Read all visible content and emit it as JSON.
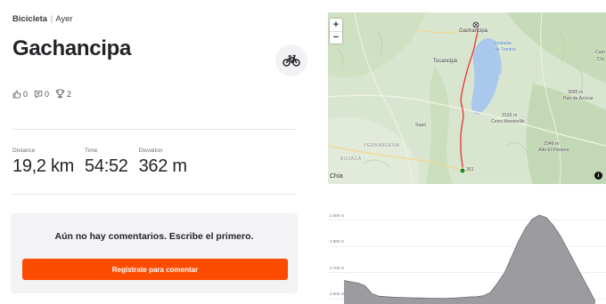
{
  "activity": {
    "type": "Bicicleta",
    "separator": "|",
    "date": "Ayer",
    "title": "Gachancipa",
    "sport_icon": "bike-icon"
  },
  "social": {
    "kudos_count": "0",
    "comments_count": "0",
    "achievements_count": "2"
  },
  "stats": [
    {
      "label": "Distance",
      "value": "19,2 km"
    },
    {
      "label": "Time",
      "value": "54:52"
    },
    {
      "label": "Elevation",
      "value": "362 m"
    }
  ],
  "comments": {
    "empty_text": "Aún no hay comentarios. Escribe el primero.",
    "button_label": "Regístrate para comentar"
  },
  "map": {
    "zoom_in": "+",
    "zoom_out": "−",
    "info": "i",
    "labels": {
      "gachancipa": "Gachancipá",
      "embalse": "Embalse",
      "de_tomine": "de Tominé",
      "tocancipa": "Tocancipá",
      "cerro_montecillo_elev": "3102 m",
      "cerro_montecillo": "Cerro Montecillo",
      "pan_de_azucar_elev": "3585 m",
      "pan_de_azucar": "Pan de Azúcar",
      "alto_paramo_elev": "3346 m",
      "alto_paramo": "Alto El Páramo",
      "yerbabuena": "YERBABUENA",
      "bojaca": "BOJACÁ",
      "sopo": "Sopó",
      "cam": "Cam",
      "chi": "Chi",
      "chia": "Chía",
      "elev_361": "361"
    },
    "colors": {
      "route": "#e8312f",
      "start": "#1f8a1f",
      "water": "#a9c8ec"
    }
  },
  "elevation": {
    "y_ticks": [
      "2.900 m",
      "2.800 m",
      "2.700 m",
      "2.600 m"
    ],
    "y_tick_values": [
      2900,
      2800,
      2700,
      2600
    ],
    "y_range": [
      2580,
      2940
    ],
    "profile": [
      2670,
      2665,
      2660,
      2650,
      2620,
      2610,
      2608,
      2606,
      2605,
      2604,
      2603,
      2603,
      2602,
      2602,
      2601,
      2602,
      2603,
      2605,
      2607,
      2608,
      2612,
      2625,
      2660,
      2700,
      2760,
      2820,
      2870,
      2905,
      2920,
      2910,
      2880,
      2840,
      2790,
      2740,
      2690,
      2640,
      2590
    ],
    "colors": {
      "fill": "#9c9ca0",
      "stroke": "#6e6e72",
      "grid": "#e4e4e8"
    }
  }
}
